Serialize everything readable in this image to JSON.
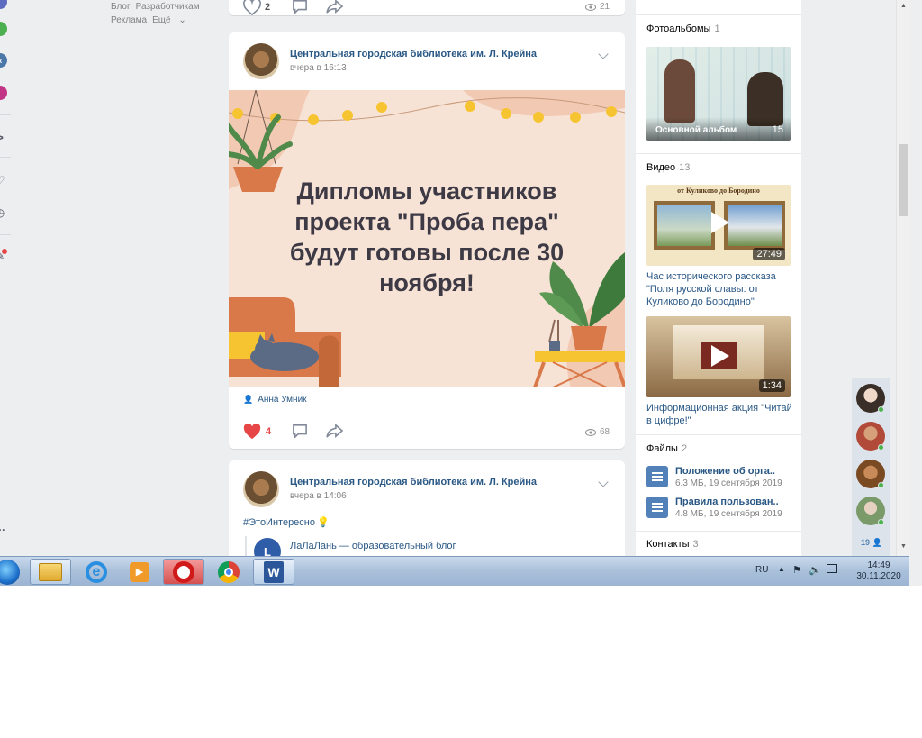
{
  "left_links": {
    "blog": "Блог",
    "developers": "Разработчикам",
    "ads": "Реклама",
    "more": "Ещё"
  },
  "top_post": {
    "likes": "2",
    "views": "21"
  },
  "post1": {
    "author": "Центральная городская библиотека им. Л. Крейна",
    "time": "вчера в 16:13",
    "banner_text": "Дипломы участников проекта \"Проба пера\" будут готовы после 30 ноября!",
    "signer": "Анна Умник",
    "likes": "4",
    "views": "68"
  },
  "post2": {
    "author": "Центральная городская библиотека им. Л. Крейна",
    "time": "вчера в 14:06",
    "hashtag": "#ЭтоИнтересно",
    "repost_author": "ЛаЛаЛань — образовательный блог"
  },
  "sidebar": {
    "albums": {
      "title": "Фотоальбомы",
      "count": "1",
      "album_name": "Основной альбом",
      "album_count": "15"
    },
    "videos": {
      "title": "Видео",
      "count": "13",
      "items": [
        {
          "caption": "от Куликово до Бородино",
          "duration": "27:49",
          "title": "Час исторического рассказа \"Поля русской славы: от Куликово до Бородино\""
        },
        {
          "duration": "1:34",
          "title": "Информационная акция \"Читай в цифре!\""
        }
      ]
    },
    "files": {
      "title": "Файлы",
      "count": "2",
      "items": [
        {
          "name": "Положение об орга..",
          "meta": "6.3 МБ, 19 сентября 2019"
        },
        {
          "name": "Правила пользован..",
          "meta": "4.8 МБ, 19 сентября 2019"
        }
      ]
    },
    "contacts": {
      "title": "Контакты",
      "count": "3"
    }
  },
  "chat": {
    "online_count": "19"
  },
  "taskbar": {
    "lang": "RU",
    "time": "14:49",
    "date": "30.11.2020"
  },
  "colors": {
    "vk_link": "#2a5885",
    "like_red": "#e64646",
    "vk_blue": "#5181b8"
  }
}
